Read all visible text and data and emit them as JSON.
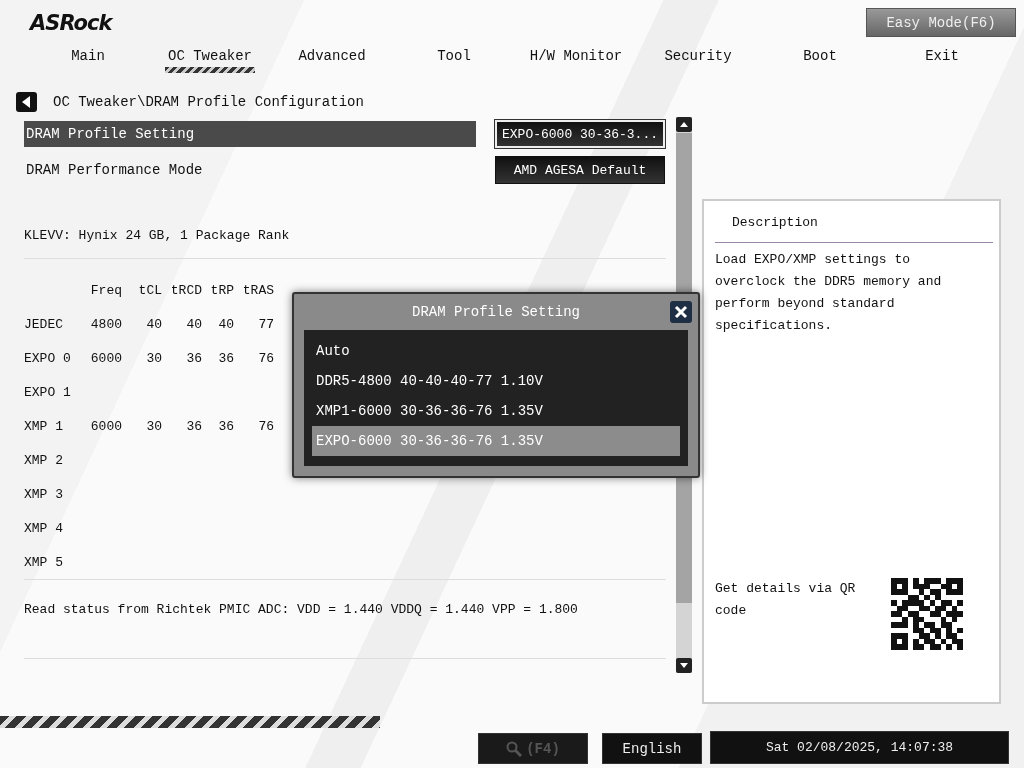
{
  "header": {
    "logo": "ASRock",
    "easy_mode_button": "Easy Mode(F6)"
  },
  "tabs": [
    {
      "label": "Main",
      "selected": false
    },
    {
      "label": "OC Tweaker",
      "selected": true
    },
    {
      "label": "Advanced",
      "selected": false
    },
    {
      "label": "Tool",
      "selected": false
    },
    {
      "label": "H/W Monitor",
      "selected": false
    },
    {
      "label": "Security",
      "selected": false
    },
    {
      "label": "Boot",
      "selected": false
    },
    {
      "label": "Exit",
      "selected": false
    }
  ],
  "breadcrumb": "OC Tweaker\\DRAM Profile Configuration",
  "settings": [
    {
      "label": "DRAM Profile Setting",
      "value": "EXPO-6000 30-36-3...",
      "selected": true
    },
    {
      "label": "DRAM Performance Mode",
      "value": "AMD AGESA Default",
      "selected": false
    }
  ],
  "module_info": "KLEVV: Hynix 24 GB, 1 Package Rank",
  "timing_table": {
    "columns": [
      "Freq",
      "tCL",
      "tRCD",
      "tRP",
      "tRAS"
    ],
    "rows": [
      {
        "profile": "JEDEC",
        "cells": [
          "4800",
          "40",
          "40",
          "40",
          "77"
        ]
      },
      {
        "profile": "EXPO 0",
        "cells": [
          "6000",
          "30",
          "36",
          "36",
          "76"
        ]
      },
      {
        "profile": "EXPO 1"
      },
      {
        "profile": "XMP 1",
        "cells": [
          "6000",
          "30",
          "36",
          "36",
          "76"
        ]
      },
      {
        "profile": "XMP 2"
      },
      {
        "profile": "XMP 3"
      },
      {
        "profile": "XMP 4"
      },
      {
        "profile": "XMP 5"
      }
    ]
  },
  "pmic_status": "Read status from Richtek PMIC ADC: VDD = 1.440 VDDQ = 1.440 VPP = 1.800",
  "description": {
    "title": "Description",
    "text": "Load EXPO/XMP settings to overclock the DDR5 memory and perform beyond standard specifications.",
    "qr_caption": "Get details via QR code"
  },
  "dialog": {
    "title": "DRAM Profile Setting",
    "options": [
      {
        "label": "Auto",
        "selected": false
      },
      {
        "label": "DDR5-4800 40-40-40-77 1.10V",
        "selected": false
      },
      {
        "label": "XMP1-6000 30-36-36-76 1.35V",
        "selected": false
      },
      {
        "label": "EXPO-6000 30-36-36-76 1.35V",
        "selected": true
      }
    ]
  },
  "footer": {
    "search_button": "(F4)",
    "language_button": "English",
    "datetime": "Sat 02/08/2025, 14:07:38"
  }
}
